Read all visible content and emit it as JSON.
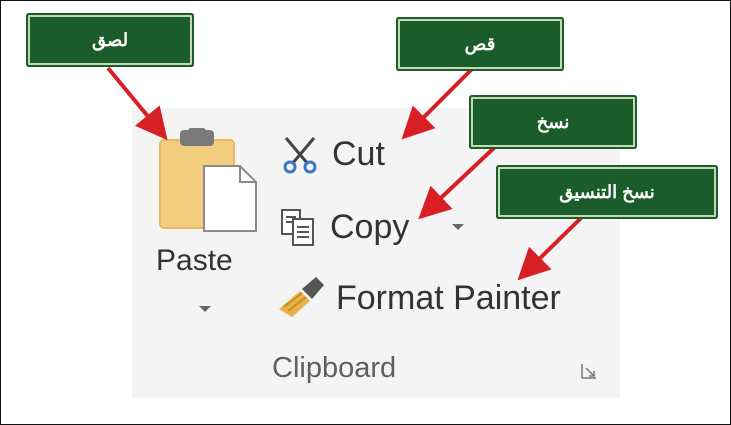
{
  "ribbon": {
    "group_label": "Clipboard",
    "paste_label": "Paste",
    "cut_label": "Cut",
    "copy_label": "Copy",
    "format_painter_label": "Format Painter",
    "icons": {
      "paste": "clipboard-paste-icon",
      "cut": "scissors-icon",
      "copy": "copy-icon",
      "format_painter": "paintbrush-icon",
      "launcher": "dialog-launcher-icon"
    }
  },
  "callouts": {
    "paste": "لصق",
    "cut": "قص",
    "copy": "نسخ",
    "format_painter": "نسخ التنسيق"
  },
  "colors": {
    "callout_bg": "#1a5c2a",
    "arrow": "#d81f26",
    "clipboard": "#f4ce7f"
  }
}
